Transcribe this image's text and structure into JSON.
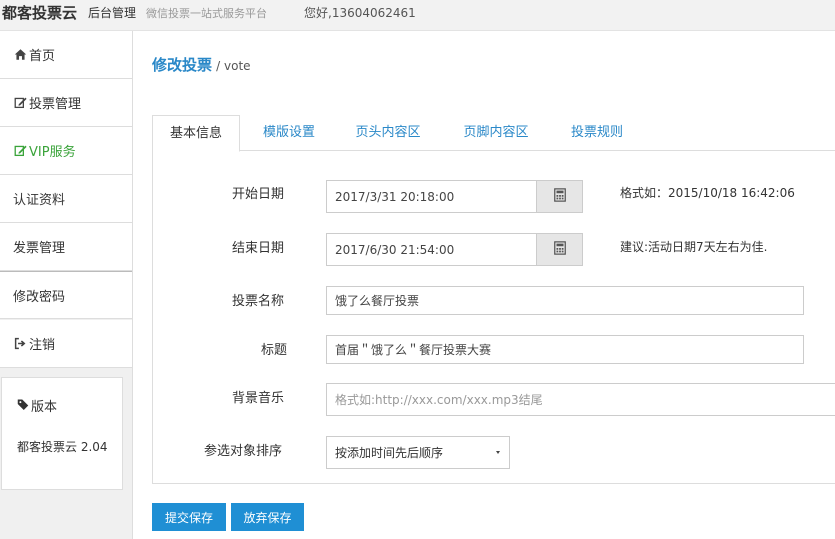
{
  "header": {
    "brand": "都客投票云",
    "subtitle": "后台管理",
    "tagline": "微信投票一站式服务平台",
    "greeting": "您好,13604062461"
  },
  "sidebar": {
    "items": [
      {
        "label": "首页",
        "icon": "home-icon"
      },
      {
        "label": "投票管理",
        "icon": "edit-icon"
      },
      {
        "label": "VIP服务",
        "icon": "edit-icon"
      },
      {
        "label": "认证资料"
      },
      {
        "label": "发票管理"
      },
      {
        "label": "修改密码"
      },
      {
        "label": "注销",
        "icon": "sign-out-icon"
      }
    ],
    "version_title": "版本",
    "version_text": "都客投票云 2.04"
  },
  "page": {
    "title": "修改投票",
    "subtitle": "/ vote"
  },
  "tabs": [
    {
      "label": "基本信息",
      "active": true
    },
    {
      "label": "模版设置"
    },
    {
      "label": "页头内容区"
    },
    {
      "label": "页脚内容区"
    },
    {
      "label": "投票规则"
    }
  ],
  "form": {
    "start_date": {
      "label": "开始日期",
      "value": "2017/3/31 20:18:00",
      "hint": "格式如：2015/10/18 16:42:06"
    },
    "end_date": {
      "label": "结束日期",
      "value": "2017/6/30 21:54:00",
      "hint": "建议:活动日期7天左右为佳."
    },
    "vote_name": {
      "label": "投票名称",
      "value": "饿了么餐厅投票"
    },
    "title": {
      "label": "标题",
      "value": "首届＂饿了么＂餐厅投票大赛"
    },
    "music": {
      "label": "背景音乐",
      "value": "",
      "placeholder": "格式如:http://xxx.com/xxx.mp3结尾"
    },
    "sort": {
      "label": "参选对象排序",
      "selected": "按添加时间先后顺序"
    }
  },
  "actions": {
    "submit": "提交保存",
    "discard": "放弃保存"
  },
  "colors": {
    "accent": "#2a88c8",
    "button": "#1f8fd4",
    "vip": "#3aa33a"
  }
}
